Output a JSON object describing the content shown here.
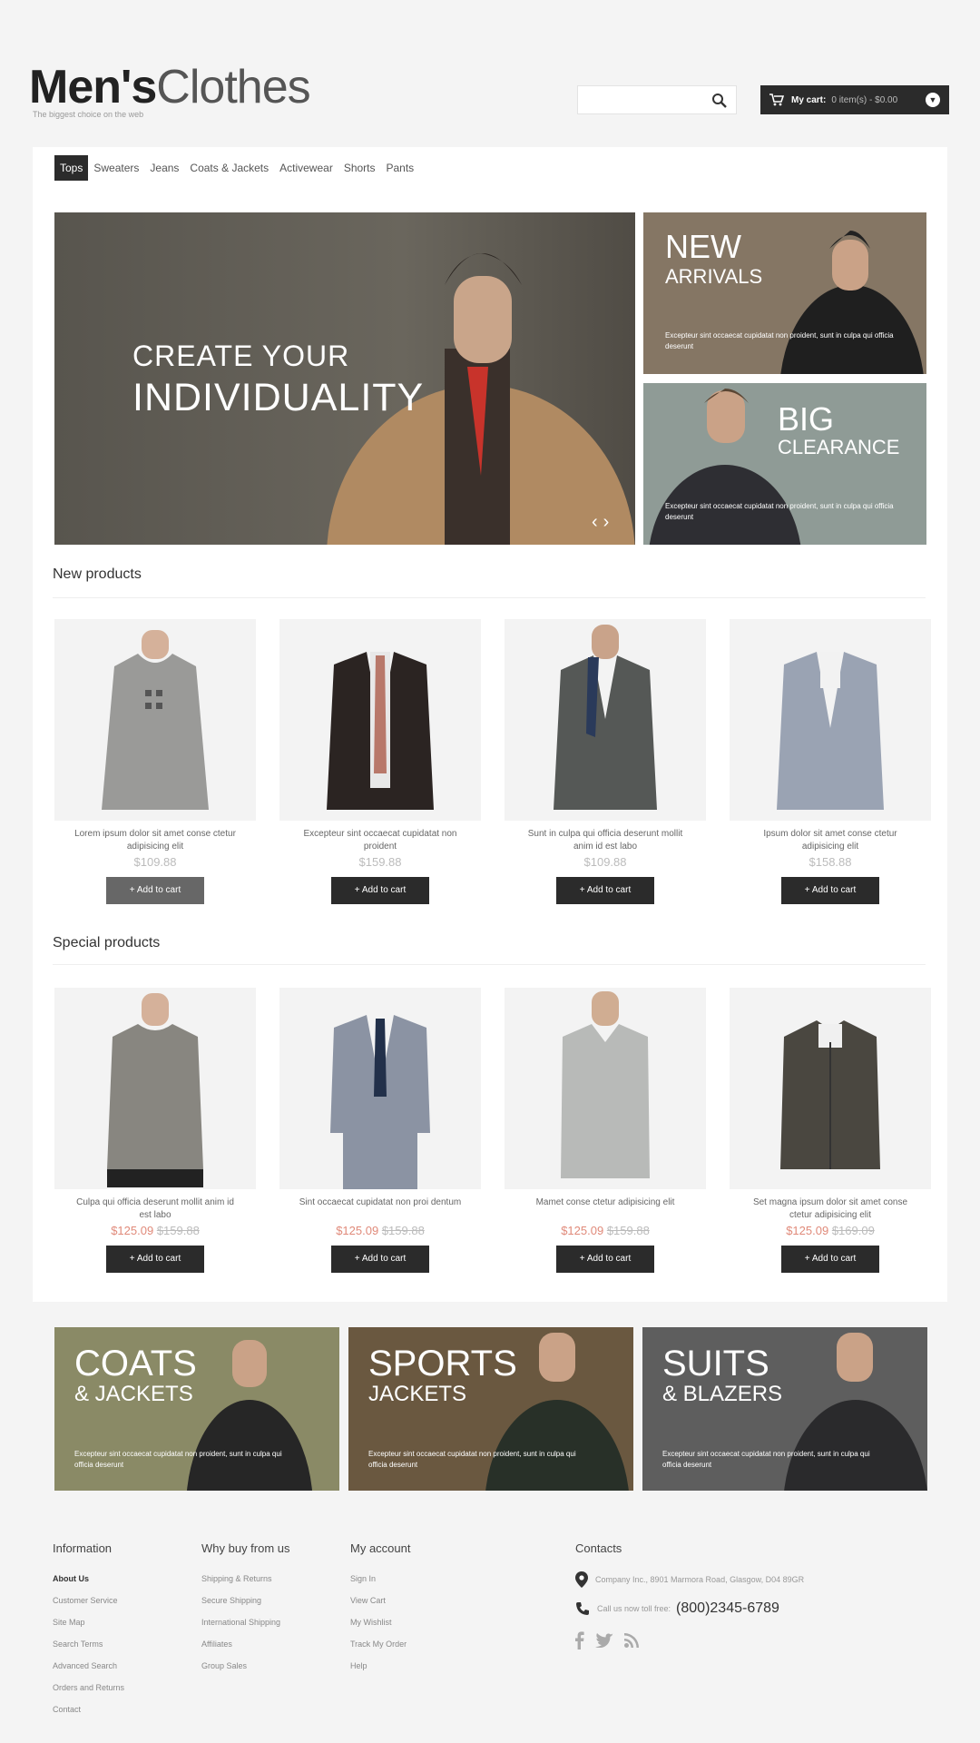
{
  "header": {
    "logo_bold": "Men's",
    "logo_thin": "Clothes",
    "tagline": "The biggest choice on the web",
    "search_placeholder": "",
    "cart_label": "My cart:",
    "cart_summary": "0 item(s) - $0.00"
  },
  "nav": [
    "Tops",
    "Sweaters",
    "Jeans",
    "Coats & Jackets",
    "Activewear",
    "Shorts",
    "Pants"
  ],
  "slider": {
    "line1": "CREATE YOUR",
    "line2": "INDIVIDUALITY"
  },
  "side_banners": [
    {
      "line1": "NEW",
      "line2": "ARRIVALS",
      "text": "Excepteur sint occaecat cupidatat non proident, sunt in culpa qui officia deserunt"
    },
    {
      "line1": "BIG",
      "line2": "CLEARANCE",
      "text": "Excepteur sint occaecat cupidatat non proident, sunt in culpa qui officia deserunt"
    }
  ],
  "new_products": {
    "title": "New products",
    "items": [
      {
        "name": "Lorem ipsum dolor sit amet conse ctetur adipisicing elit",
        "price": "$109.88",
        "button": "Add to cart"
      },
      {
        "name": "Excepteur sint occaecat cupidatat non proident",
        "price": "$159.88",
        "button": "Add to cart"
      },
      {
        "name": "Sunt in culpa qui officia deserunt mollit anim id est labo",
        "price": "$109.88",
        "button": "Add to cart"
      },
      {
        "name": "Ipsum dolor sit amet conse ctetur adipisicing elit",
        "price": "$158.88",
        "button": "Add to cart"
      }
    ]
  },
  "special_products": {
    "title": "Special products",
    "items": [
      {
        "name": "Culpa qui officia deserunt mollit anim id est labo",
        "price": "$125.09",
        "old_price": "$159.88",
        "button": "Add to cart"
      },
      {
        "name": "Sint occaecat cupidatat non proi dentum",
        "price": "$125.09",
        "old_price": "$159.88",
        "button": "Add to cart"
      },
      {
        "name": "Mamet conse ctetur adipisicing elit",
        "price": "$125.09",
        "old_price": "$159.88",
        "button": "Add to cart"
      },
      {
        "name": "Set magna ipsum dolor sit amet conse ctetur adipisicing elit",
        "price": "$125.09",
        "old_price": "$169.09",
        "button": "Add to cart"
      }
    ]
  },
  "categories": [
    {
      "line1": "COATS",
      "line2": "& JACKETS",
      "text": "Excepteur sint occaecat cupidatat non proident, sunt in culpa qui officia deserunt",
      "color": "#8a8a66"
    },
    {
      "line1": "SPORTS",
      "line2": "JACKETS",
      "text": "Excepteur sint occaecat cupidatat non proident, sunt in culpa qui officia deserunt",
      "color": "#6a5840"
    },
    {
      "line1": "SUITS",
      "line2": "& BLAZERS",
      "text": "Excepteur sint occaecat cupidatat non proident, sunt in culpa qui officia deserunt",
      "color": "#5e5e5e"
    }
  ],
  "footer": {
    "information": {
      "title": "Information",
      "links": [
        "About Us",
        "Customer Service",
        "Site Map",
        "Search Terms",
        "Advanced Search",
        "Orders and Returns",
        "Contact"
      ]
    },
    "why_buy": {
      "title": "Why buy from us",
      "links": [
        "Shipping & Returns",
        "Secure Shipping",
        "International Shipping",
        "Affiliates",
        "Group Sales"
      ]
    },
    "account": {
      "title": "My account",
      "links": [
        "Sign In",
        "View Cart",
        "My Wishlist",
        "Track My Order",
        "Help"
      ]
    },
    "contacts": {
      "title": "Contacts",
      "address": "Company Inc., 8901 Marmora Road, Glasgow, D04 89GR",
      "phone_label": "Call us now toll free:",
      "phone": "(800)2345-6789"
    }
  },
  "colors": {
    "dark": "#2b2b2b",
    "accent_sale": "#e08a7a"
  }
}
